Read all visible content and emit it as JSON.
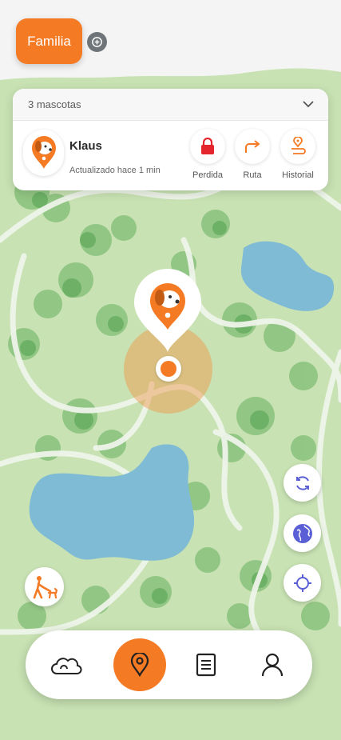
{
  "header": {
    "group_button_label": "Familia",
    "share_icon": "share-location-icon"
  },
  "pet_card": {
    "pet_count_label": "3 mascotas",
    "expand_icon": "chevron-down-icon",
    "pet": {
      "name": "Klaus",
      "updated_text": "Actualizado hace 1 min",
      "avatar_icon": "dog-pin-icon"
    },
    "actions": [
      {
        "label": "Perdida",
        "icon": "lock-icon",
        "color": "#e5252d"
      },
      {
        "label": "Ruta",
        "icon": "route-arrow-icon",
        "color": "#f47a24"
      },
      {
        "label": "Historial",
        "icon": "history-pin-icon",
        "color": "#f47a24"
      }
    ]
  },
  "map": {
    "pet_marker_icon": "dog-pin-icon",
    "location_dot_icon": "location-dot-icon",
    "floating_buttons": [
      {
        "name": "refresh",
        "icon": "refresh-icon"
      },
      {
        "name": "globe",
        "icon": "globe-icon"
      },
      {
        "name": "locate",
        "icon": "crosshair-icon"
      },
      {
        "name": "walk",
        "icon": "walking-dog-icon"
      }
    ]
  },
  "bottom_nav": {
    "items": [
      {
        "name": "weather",
        "icon": "cloud-icon",
        "active": false
      },
      {
        "name": "map",
        "icon": "map-pin-icon",
        "active": true
      },
      {
        "name": "notes",
        "icon": "notes-icon",
        "active": false
      },
      {
        "name": "profile",
        "icon": "user-icon",
        "active": false
      }
    ]
  },
  "colors": {
    "accent": "#f47a24",
    "danger": "#e5252d",
    "map_green": "#c9e3b5",
    "water": "#79b8d4",
    "tree": "#7cbc72"
  }
}
